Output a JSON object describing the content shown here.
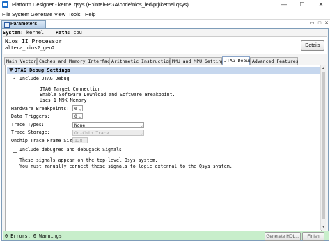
{
  "window": {
    "title": "Platform Designer - kernel.qsys (E:\\intelFPGA\\code\\nios_led\\prj\\kernel.qsys)",
    "minimize": "—",
    "maximize": "☐",
    "close": "✕"
  },
  "menu": [
    "File",
    "System",
    "Generate",
    "View",
    "Tools",
    "Help"
  ],
  "panel": {
    "tab_label": "Parameters",
    "system_label": "System:",
    "system_value": "kernel",
    "path_label": "Path:",
    "path_value": "cpu"
  },
  "component": {
    "name": "Nios II Processor",
    "id": "altera_nios2_gen2",
    "details_button": "Details"
  },
  "tabs": [
    {
      "label": "Main Vectors",
      "active": false
    },
    {
      "label": "Caches and Memory Interfaces",
      "active": false
    },
    {
      "label": "Arithmetic Instructions",
      "active": false
    },
    {
      "label": "MMU and MPU Settings",
      "active": false
    },
    {
      "label": "JTAG Debug",
      "active": true
    },
    {
      "label": "Advanced Features",
      "active": false
    }
  ],
  "jtag": {
    "section_title": "JTAG Debug Settings",
    "include_jtag_label": "Include JTAG Debug",
    "include_jtag_checked": true,
    "description": [
      "JTAG Target Connection.",
      "Enable Software Download and Software Breakpoint.",
      "Uses 1 M9K Memory."
    ],
    "hw_breakpoints_label": "Hardware Breakpoints:",
    "hw_breakpoints_value": "0",
    "data_triggers_label": "Data Triggers:",
    "data_triggers_value": "0",
    "trace_types_label": "Trace Types:",
    "trace_types_value": "None",
    "trace_storage_label": "Trace Storage:",
    "trace_storage_value": "On-Chip Trace",
    "onchip_trace_label": "Onchip Trace Frame Size:",
    "onchip_trace_value": "128",
    "debugreq_label": "Include debugreq and debugack Signals",
    "debugreq_checked": false,
    "debugreq_description": [
      "These signals appear on the top-level Qsys system.",
      "You must manually connect these signals to logic external to the Qsys system."
    ]
  },
  "status": {
    "messages": "0 Errors, 0 Warnings",
    "generate_button": "Generate HDL...",
    "finish_button": "Finish"
  }
}
